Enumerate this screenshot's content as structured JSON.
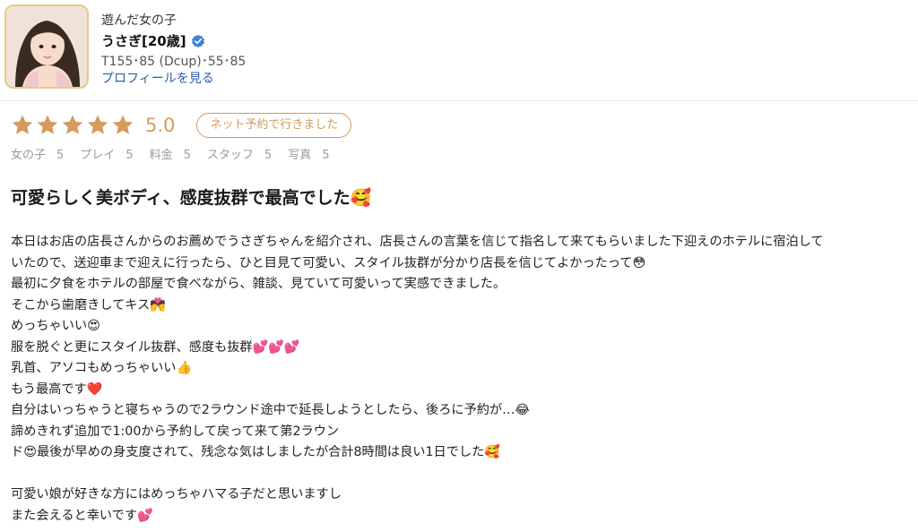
{
  "header": {
    "caption": "遊んだ女の子",
    "girl_name": "うさぎ[20歳]",
    "stats": "T155･85 (Dcup)･55･85",
    "profile_link": "プロフィールを見る"
  },
  "review": {
    "stars": 5,
    "score": "5.0",
    "badge": "ネット予約で行きました",
    "sub_scores": [
      {
        "label": "女の子",
        "value": "5"
      },
      {
        "label": "プレイ",
        "value": "5"
      },
      {
        "label": "料金",
        "value": "5"
      },
      {
        "label": "スタッフ",
        "value": "5"
      },
      {
        "label": "写真",
        "value": "5"
      }
    ],
    "title": "可愛らしく美ボディ、感度抜群で最高でした🥰",
    "lines": [
      "本日はお店の店長さんからのお薦めでうさぎちゃんを紹介され、店長さんの言葉を信じて指名して来てもらいました下迎えのホテルに宿泊して",
      "いたので、送迎車まで迎えに行ったら、ひと目見て可愛い、スタイル抜群が分かり店長を信じてよかったって😳",
      "最初に夕食をホテルの部屋で食べながら、雑談、見ていて可愛いって実感できました。",
      "そこから歯磨きしてキス💏",
      "めっちゃいい😍",
      "服を脱ぐと更にスタイル抜群、感度も抜群💕💕💕",
      "乳首、アソコもめっちゃいい👍",
      "もう最高です❤️",
      "自分はいっちゃうと寝ちゃうので2ラウンド途中で延長しようとしたら、後ろに予約が…😂",
      "諦めきれず追加で1:00から予約して戻って来て第2ラウン",
      "ド😍最後が早めの身支度されて、残念な気はしましたが合計8時間は良い1日でした🥰",
      "",
      "可愛い娘が好きな方にはめっちゃハマる子だと思いますし",
      "また会えると幸いです💕"
    ]
  },
  "colors": {
    "accent": "#d59a5c",
    "link": "#2a5db0",
    "verified": "#3b82d6",
    "muted": "#9a9a9a"
  },
  "icons": {
    "verified": "verified-check-icon",
    "star": "star-icon"
  }
}
